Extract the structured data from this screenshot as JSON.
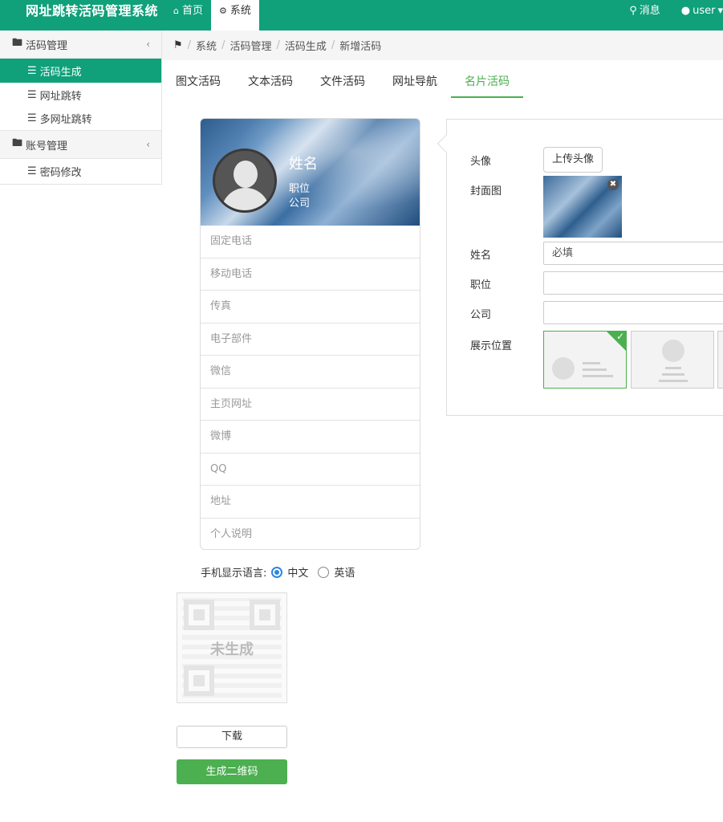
{
  "app": {
    "title": "网址跳转活码管理系统"
  },
  "topnav": {
    "home": "首页",
    "system": "系统",
    "messages": "消息",
    "user": "user"
  },
  "sidebar": {
    "groups": [
      {
        "label": "活码管理",
        "items": [
          "活码生成",
          "网址跳转",
          "多网址跳转"
        ]
      },
      {
        "label": "账号管理",
        "items": [
          "密码修改"
        ]
      }
    ]
  },
  "breadcrumb": [
    "系统",
    "活码管理",
    "活码生成",
    "新增活码"
  ],
  "tabs": [
    "图文活码",
    "文本活码",
    "文件活码",
    "网址导航",
    "名片活码"
  ],
  "card": {
    "name": "姓名",
    "position": "职位",
    "company": "公司",
    "fields": [
      "固定电话",
      "移动电话",
      "传真",
      "电子部件",
      "微信",
      "主页网址",
      "微博",
      "QQ",
      "地址",
      "个人说明"
    ]
  },
  "language": {
    "label": "手机显示语言:",
    "options": [
      "中文",
      "英语"
    ],
    "selected": "中文"
  },
  "qr": {
    "status": "未生成"
  },
  "buttons": {
    "download": "下载",
    "generate": "生成二维码"
  },
  "form": {
    "avatar_label": "头像",
    "upload_avatar": "上传头像",
    "cover_label": "封面图",
    "name_label": "姓名",
    "name_placeholder": "必填",
    "position_label": "职位",
    "company_label": "公司",
    "display_label": "展示位置"
  },
  "colors": {
    "brand": "#10a07a",
    "accent": "#4caf50"
  }
}
